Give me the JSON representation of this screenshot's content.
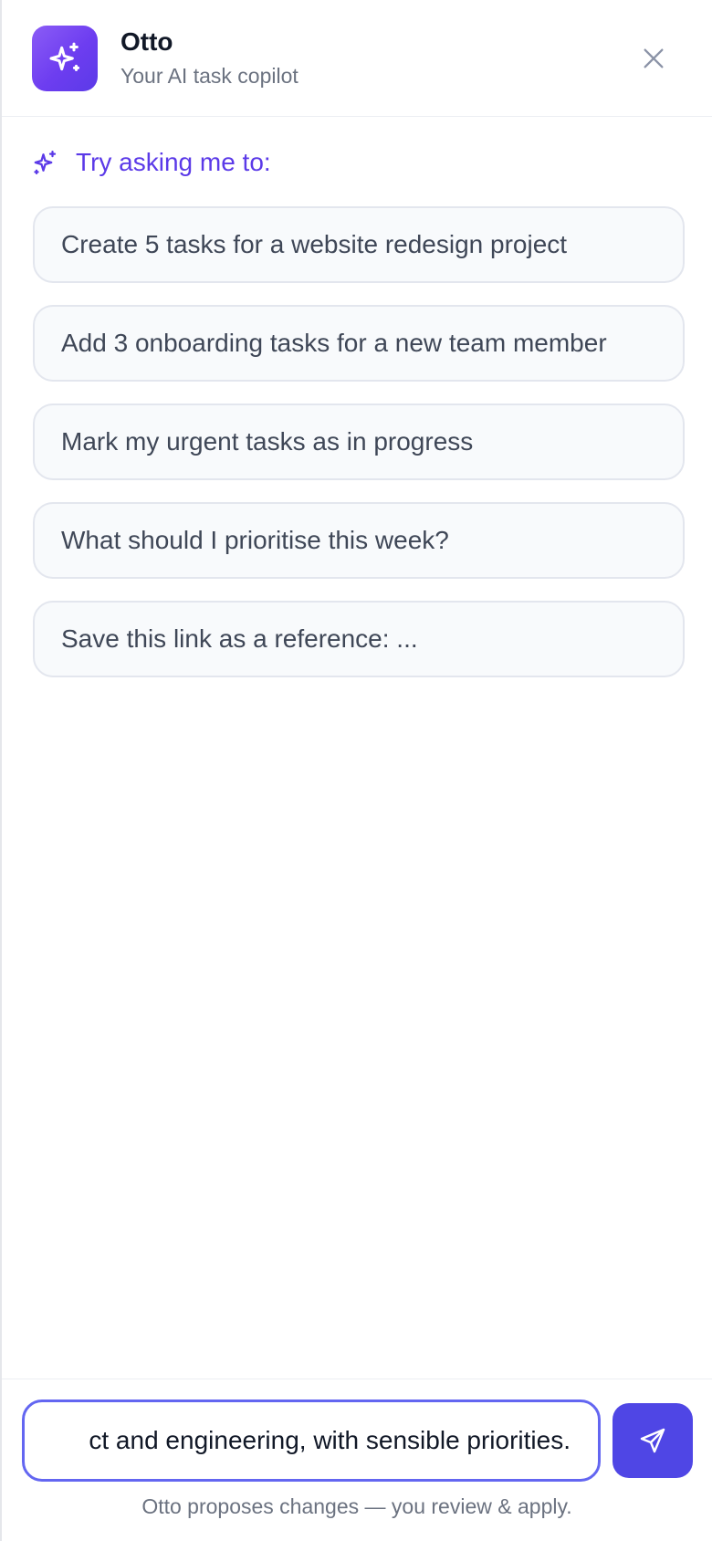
{
  "header": {
    "title": "Otto",
    "subtitle": "Your AI task copilot",
    "logo_icon": "sparkles-icon",
    "close_icon": "close-icon"
  },
  "suggestions": {
    "heading": "Try asking me to:",
    "heading_icon": "sparkles-icon",
    "items": [
      "Create 5 tasks for a website redesign project",
      "Add 3 onboarding tasks for a new team member",
      "Mark my urgent tasks as in progress",
      "What should I prioritise this week?",
      "Save this link as a reference: ..."
    ]
  },
  "composer": {
    "input_value": "ct and engineering, with sensible priorities.",
    "send_icon": "send-icon",
    "disclaimer": "Otto proposes changes — you review & apply."
  },
  "colors": {
    "accent": "#4f46e5",
    "accent_text": "#5b3ae8",
    "logo_gradient_start": "#8b5cf6",
    "logo_gradient_end": "#5b3ae8",
    "input_border": "#6366f1"
  }
}
